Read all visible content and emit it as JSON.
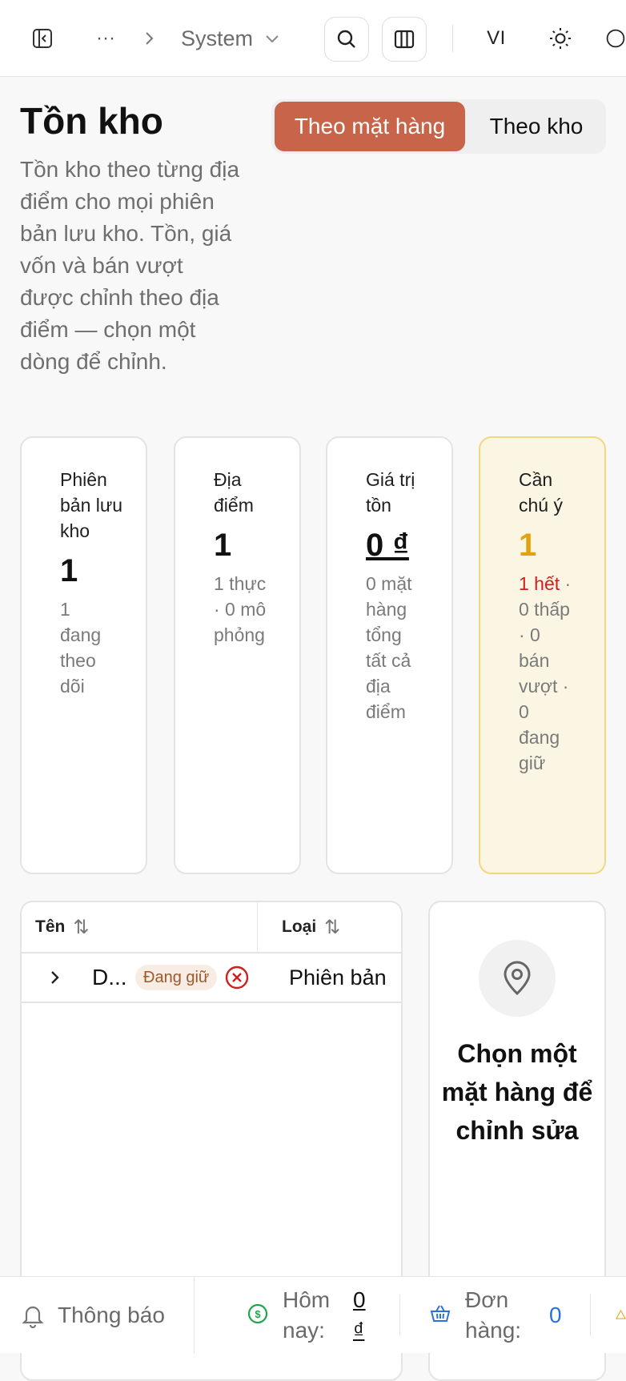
{
  "topbar": {
    "crumb_more": "···",
    "crumb_current": "System",
    "language": "VI"
  },
  "header": {
    "title": "Tồn kho",
    "description": "Tồn kho theo từng địa điểm cho mọi phiên bản lưu kho. Tồn, giá vốn và bán vượt được chỉnh theo địa điểm — chọn một dòng để chỉnh.",
    "view_toggle": {
      "by_item": "Theo mặt hàng",
      "by_warehouse": "Theo kho",
      "selected": "by_item"
    }
  },
  "stats": {
    "variants": {
      "label": "Phiên bản lưu kho",
      "value": "1",
      "sub": "1 đang theo dõi"
    },
    "locations": {
      "label": "Địa điểm",
      "value": "1",
      "sub": "1 thực · 0 mô phỏng"
    },
    "stock_value": {
      "label": "Giá trị tồn",
      "value": "0 ₫",
      "sub": "0 mặt hàng tổng tất cả địa điểm"
    },
    "attention": {
      "label": "Cần chú ý",
      "value": "1",
      "sub_red": "1 hết",
      "sub": "· 0 thấp · 0 bán vượt · 0 đang giữ"
    }
  },
  "table": {
    "columns": [
      "Tên",
      "Loại"
    ],
    "rows": [
      {
        "name": "D...",
        "badge": "Đang giữ",
        "type": "Phiên bản"
      }
    ]
  },
  "detail_panel": {
    "message": "Chọn một mặt hàng để chỉnh sửa"
  },
  "statusbar": {
    "notifications": "Thông báo",
    "today_label": "Hôm nay:",
    "today_value": "0 ₫",
    "orders_label": "Đơn hàng:",
    "orders_value": "0"
  },
  "colors": {
    "accent": "#c8644a",
    "warning_bg": "#fbf6e4",
    "warning_border": "#f2d782",
    "amber": "#e4a10e",
    "danger": "#d31d1d",
    "link_blue": "#2a72d9"
  }
}
